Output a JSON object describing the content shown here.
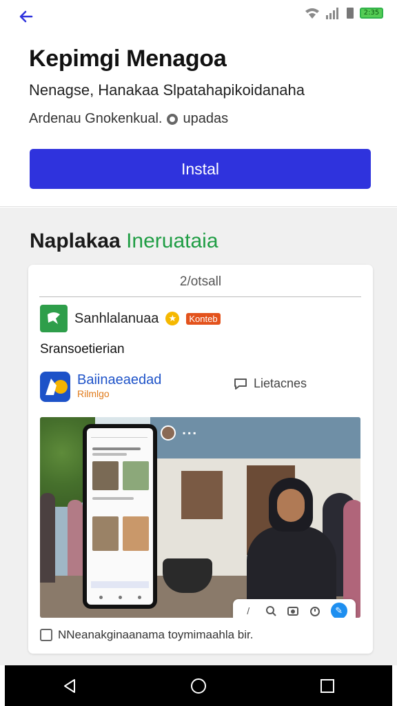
{
  "status_bar": {
    "icons": [
      "wifi-icon",
      "signal-icon",
      "sim-icon",
      "battery-icon"
    ],
    "battery_text": "2:35"
  },
  "header": {
    "back_icon": "arrow-left-icon",
    "title": "Kepimgi Menagoa",
    "subtitle": "Nenagse, Hanakaa Slpatahapikoidanaha",
    "meta": "Ardenau Gnokenkual.",
    "meta_icon": "clock-icon",
    "meta_link": "upadas",
    "install_label": "Instal"
  },
  "section": {
    "heading_bold": "Naplakaa",
    "heading_accent": "Ineruataia",
    "card": {
      "tab_label": "2/otsall",
      "row1": {
        "icon": "green-app-icon",
        "label": "Sanhlalanuaa",
        "badge_icon": "star-icon",
        "badge": "Konteb"
      },
      "row2_label": "Sransoetierian",
      "row3": {
        "icon": "blue-app-icon",
        "title": "Baiinaeaedad",
        "subtitle": "Rilmlgo",
        "link_icon": "chat-icon",
        "link_label": "Lietacnes"
      },
      "photo_icon": "photo",
      "toolbar_icons": [
        "pen-icon",
        "search-icon",
        "camera-icon",
        "timer-icon",
        "edit-fab-icon"
      ],
      "caption_icon": "image-icon",
      "caption": "NNeanakginaanama toymimaahla bir."
    }
  },
  "navbar": {
    "buttons": [
      "back-triangle-icon",
      "home-circle-icon",
      "recents-square-icon"
    ]
  },
  "colors": {
    "primary": "#2f33dd",
    "accent_green": "#1f9d44",
    "badge_orange": "#e3521c",
    "link_blue": "#1d52c8"
  }
}
